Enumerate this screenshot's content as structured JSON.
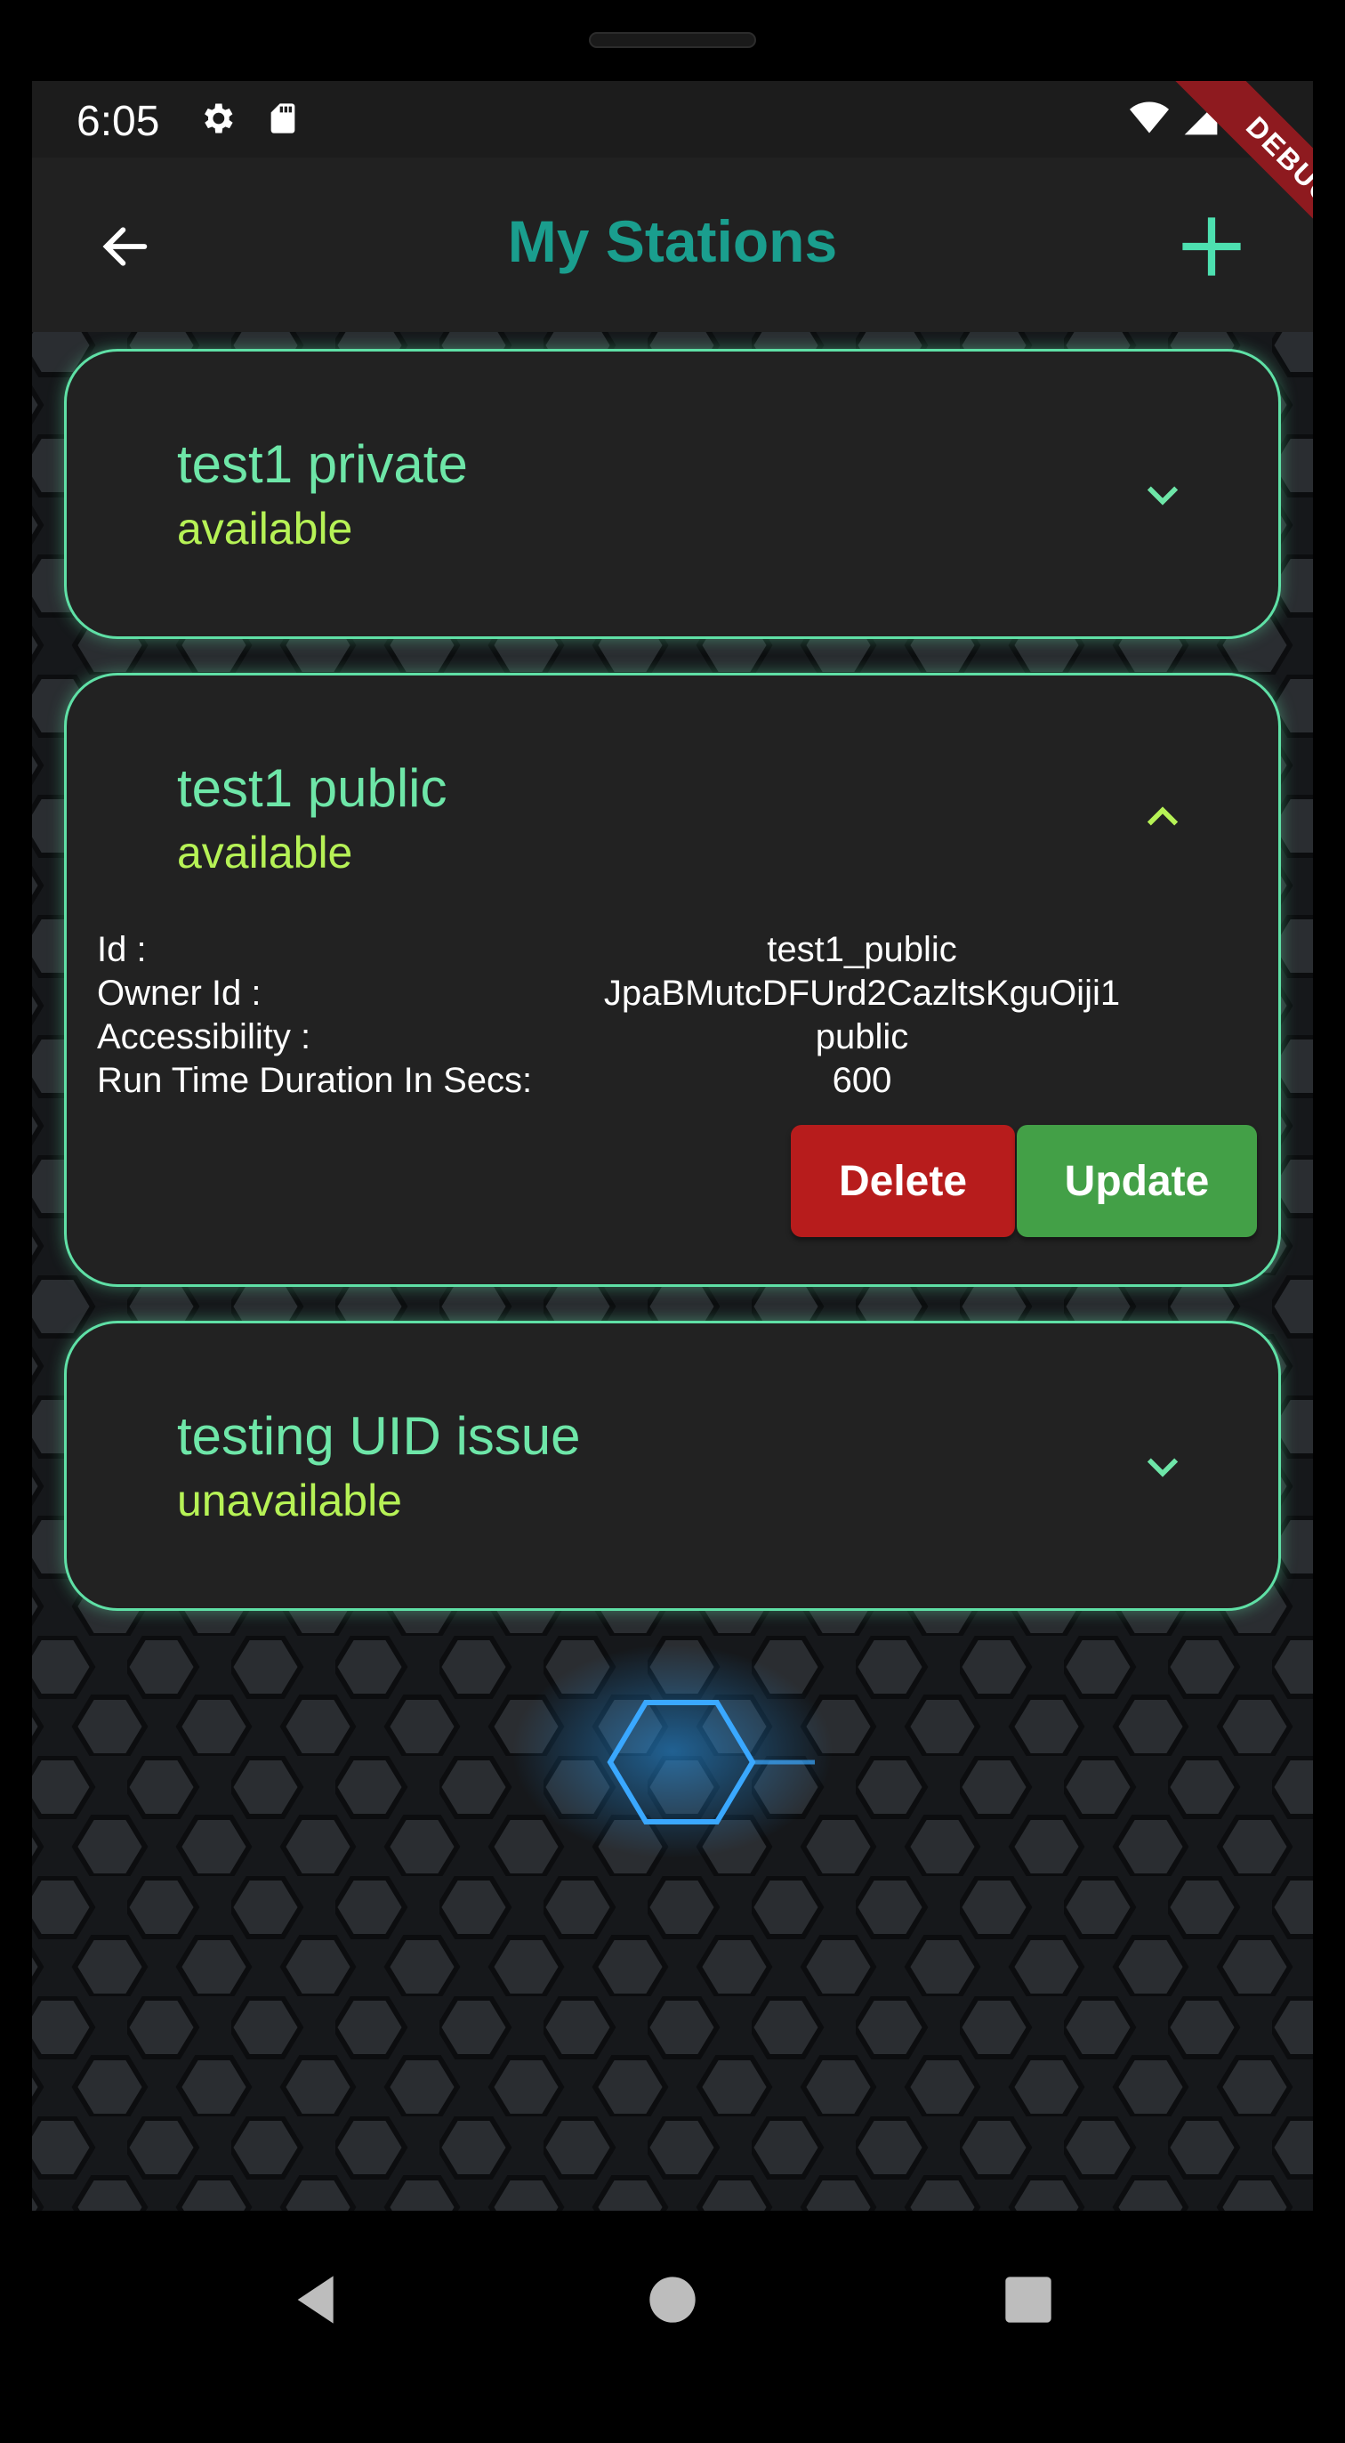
{
  "status_bar": {
    "time": "6:05",
    "left_icons": [
      "settings-icon",
      "sd-card-icon"
    ],
    "right_icons": [
      "wifi-icon",
      "signal-icon",
      "battery-icon"
    ]
  },
  "debug_banner": "DEBUG",
  "app_bar": {
    "back_icon": "arrow-back-icon",
    "title": "My Stations",
    "add_icon": "plus-icon",
    "title_color": "#1a9e8e",
    "icon_color": "#4de0b0"
  },
  "stations": [
    {
      "name": "test1 private",
      "status": "available",
      "expanded": false
    },
    {
      "name": "test1 public",
      "status": "available",
      "expanded": true,
      "details": [
        {
          "label": "Id :",
          "value": "test1_public"
        },
        {
          "label": "Owner Id :",
          "value": "JpaBMutcDFUrd2CazltsKguOiji1"
        },
        {
          "label": "Accessibility :",
          "value": "public"
        },
        {
          "label": "Run Time Duration In Secs:",
          "value": "600"
        }
      ],
      "delete_label": "Delete",
      "update_label": "Update"
    },
    {
      "name": "testing UID issue",
      "status": "unavailable",
      "expanded": false
    }
  ],
  "colors": {
    "card_border": "#5fe0a6",
    "station_name": "#6ee6a8",
    "station_status": "#b6f256",
    "delete": "#b71c1c",
    "update": "#43a047"
  },
  "nav_bar": [
    "back-triangle-icon",
    "home-circle-icon",
    "recents-square-icon"
  ]
}
